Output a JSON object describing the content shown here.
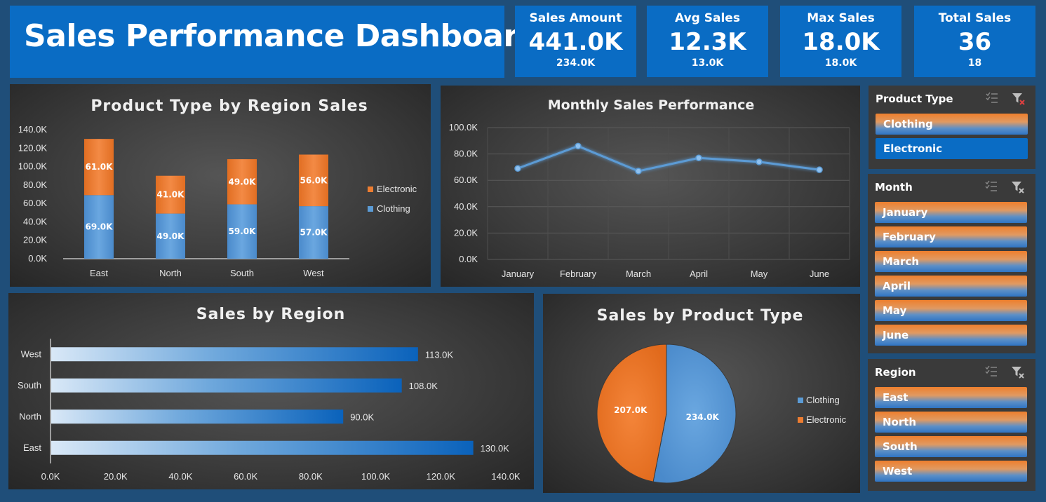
{
  "header": {
    "title": "Sales Performance Dashboard"
  },
  "kpis": [
    {
      "label": "Sales Amount",
      "value": "441.0K",
      "sub": "234.0K"
    },
    {
      "label": "Avg Sales",
      "value": "12.3K",
      "sub": "13.0K"
    },
    {
      "label": "Max Sales",
      "value": "18.0K",
      "sub": "18.0K"
    },
    {
      "label": "Total Sales",
      "value": "36",
      "sub": "18"
    }
  ],
  "colors": {
    "clothing": "#5b9bd5",
    "electronic": "#ed7d31",
    "accent": "#0a6cc4",
    "background": "#1f4e79"
  },
  "slicers": {
    "product_type": {
      "title": "Product Type",
      "items": [
        "Clothing",
        "Electronic"
      ],
      "selected": "Electronic"
    },
    "month": {
      "title": "Month",
      "items": [
        "January",
        "February",
        "March",
        "April",
        "May",
        "June"
      ]
    },
    "region": {
      "title": "Region",
      "items": [
        "East",
        "North",
        "South",
        "West"
      ]
    }
  },
  "chart_data": [
    {
      "type": "bar",
      "stacked": true,
      "title": "Product Type by Region Sales",
      "categories": [
        "East",
        "North",
        "South",
        "West"
      ],
      "series": [
        {
          "name": "Clothing",
          "values": [
            69.0,
            49.0,
            59.0,
            57.0
          ],
          "labels": [
            "69.0K",
            "49.0K",
            "59.0K",
            "57.0K"
          ],
          "color": "#5b9bd5"
        },
        {
          "name": "Electronic",
          "values": [
            61.0,
            41.0,
            49.0,
            56.0
          ],
          "labels": [
            "61.0K",
            "41.0K",
            "49.0K",
            "56.0K"
          ],
          "color": "#ed7d31"
        }
      ],
      "yticks": [
        "0.0K",
        "20.0K",
        "40.0K",
        "60.0K",
        "80.0K",
        "100.0K",
        "120.0K",
        "140.0K"
      ],
      "ylim": [
        0,
        140
      ],
      "legend": "right"
    },
    {
      "type": "line",
      "title": "Monthly Sales Performance",
      "categories": [
        "January",
        "February",
        "March",
        "April",
        "May",
        "June"
      ],
      "values": [
        69,
        86,
        67,
        77,
        74,
        68
      ],
      "yticks": [
        "0.0K",
        "20.0K",
        "40.0K",
        "60.0K",
        "80.0K",
        "100.0K"
      ],
      "ylim": [
        0,
        100
      ],
      "grid": true
    },
    {
      "type": "bar",
      "orientation": "horizontal",
      "title": "Sales by Region",
      "categories": [
        "West",
        "South",
        "North",
        "East"
      ],
      "values": [
        113,
        108,
        90,
        130
      ],
      "labels": [
        "113.0K",
        "108.0K",
        "90.0K",
        "130.0K"
      ],
      "xticks": [
        "0.0K",
        "20.0K",
        "40.0K",
        "60.0K",
        "80.0K",
        "100.0K",
        "120.0K",
        "140.0K"
      ],
      "xlim": [
        0,
        140
      ]
    },
    {
      "type": "pie",
      "title": "Sales by Product Type",
      "slices": [
        {
          "name": "Clothing",
          "value": 234,
          "label": "234.0K",
          "color": "#5b9bd5"
        },
        {
          "name": "Electronic",
          "value": 207,
          "label": "207.0K",
          "color": "#ed7d31"
        }
      ],
      "legend": "right"
    }
  ]
}
